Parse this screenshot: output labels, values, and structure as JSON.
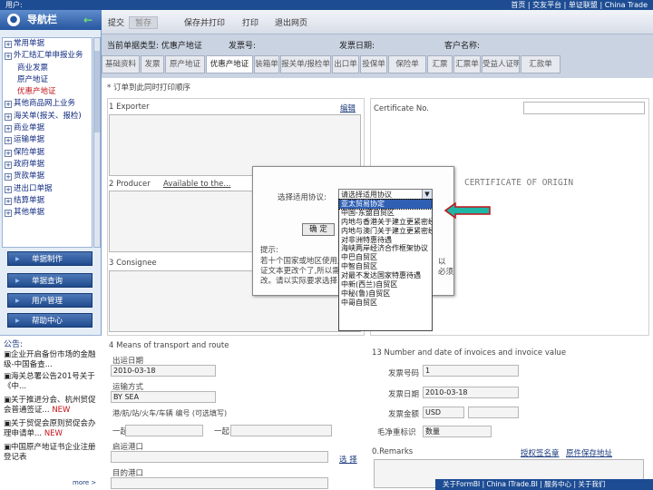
{
  "topbar": {
    "left": "用户:",
    "right": "首页 | 交友平台 | 单证联盟 | China Trade"
  },
  "nav": {
    "title": "导航栏",
    "items": [
      {
        "label": "常用单据",
        "level": 1
      },
      {
        "label": "外汇结汇单申报业务",
        "level": 1
      },
      {
        "label": "商业发票",
        "level": 2
      },
      {
        "label": "原产地证",
        "level": 2
      },
      {
        "label": "优惠产地证",
        "level": 2,
        "selected": true
      },
      {
        "label": "其他商品网上业务",
        "level": 1
      },
      {
        "label": "海关单(报关、报检)",
        "level": 1
      },
      {
        "label": "商业单据",
        "level": 1
      },
      {
        "label": "运输单据",
        "level": 1
      },
      {
        "label": "保险单据",
        "level": 1
      },
      {
        "label": "政府单据",
        "level": 1
      },
      {
        "label": "货款单据",
        "level": 1
      },
      {
        "label": "进出口单据",
        "level": 1
      },
      {
        "label": "结算单据",
        "level": 1
      },
      {
        "label": "其他单据",
        "level": 1
      }
    ],
    "buttons": [
      "单据制作",
      "单据查询",
      "用户管理",
      "帮助中心"
    ]
  },
  "news": {
    "title": "公告:",
    "items": [
      {
        "text": "企业开启备份市场的金融级-中国备查..."
      },
      {
        "text": "海关总署公告201号关于《中..."
      },
      {
        "text": "关于推进分会、杭州贸促会普通签证...",
        "badge": "NEW"
      },
      {
        "text": "关于贸促会原则贸促会办理申请单...",
        "badge": "NEW"
      },
      {
        "text": "中国原产地证书企业注册登记表",
        "badge": ""
      }
    ],
    "more": "more >"
  },
  "toolbar": {
    "b1": "提交",
    "b2": "暂存",
    "b3": "保存并打印",
    "b4": "打印",
    "b5": "退出网页"
  },
  "info": {
    "t1": "当前单据类型: 优惠产地证",
    "t2": "发票号:",
    "t3": "发票日期:",
    "t4": "客户名称:"
  },
  "tabs": [
    "基础资料",
    "发票",
    "原产地证",
    "优惠产地证",
    "装箱单",
    "报关单/报检单",
    "出口单",
    "投保单",
    "保险单",
    "汇票",
    "汇票单",
    "受益人证明",
    "汇款单"
  ],
  "form": {
    "note": "* 订单到此同时打印顺序",
    "exporter": "1 Exporter",
    "exporter_link": "编辑",
    "cert_no": "Certificate No.",
    "cert_title": "CERTIFICATE OF ORIGIN",
    "producer": "2 Producer",
    "producer_note": "Available to the...",
    "consignee": "3 Consignee",
    "means": "4 Means of transport and route",
    "depart_date_label": "出运日期",
    "depart_date": "2010-03-18",
    "ship_mode_label": "运输方式",
    "ship_mode": "BY SEA",
    "port_label": "港/航/站/火车/车辆 编号 (可选填写)",
    "from_label": "一起",
    "to_label": "一起",
    "from_port_label": "启运港口",
    "dest_port_label": "目的港口",
    "choose": "选 择",
    "invoice_section": "13 Number and date of invoices and invoice value",
    "inv_no_label": "发票号码",
    "inv_no": "1",
    "inv_date_label": "发票日期",
    "inv_date": "2010-03-18",
    "currency_label": "发票金额",
    "currency": "USD",
    "unit_label": "毛净重标识",
    "unit": "数量",
    "remarks": "0.Remarks",
    "remarks_link1": "授权签名章",
    "remarks_link2": "原件保存地址"
  },
  "dialog": {
    "label": "选择适用协议:",
    "selected": "请选择适用协议",
    "ok": "确 定",
    "hint_title": "提示:",
    "hint1": "若十个国家或地区使用产",
    "hint2": "证文本更改个了,所以需",
    "hint3": "改。请以实际要求选择",
    "hint_right1": "以",
    "hint_right2": "必须",
    "options": [
      "亚太贸易协定",
      "中国-东盟自贸区",
      "内地与香港关于建立更紧密经贸关系的安排",
      "内地与澳门关于建立更紧密经贸关系的安排",
      "对非洲特惠待遇",
      "海峡两岸经济合作框架协议",
      "中巴自贸区",
      "中智自贸区",
      "对最不发达国家特惠待遇",
      "中新(西兰)自贸区",
      "中秘(鲁)自贸区",
      "中哥自贸区"
    ]
  },
  "footer": {
    "text": "关于FormBI | China ITrade.BI | 服务中心 | 关于我们"
  },
  "colors": {
    "accent": "#1d4c93",
    "highlight": "#2f5fb3",
    "arrow": "#c4131a",
    "arrow_fill": "#1fb6a6"
  }
}
